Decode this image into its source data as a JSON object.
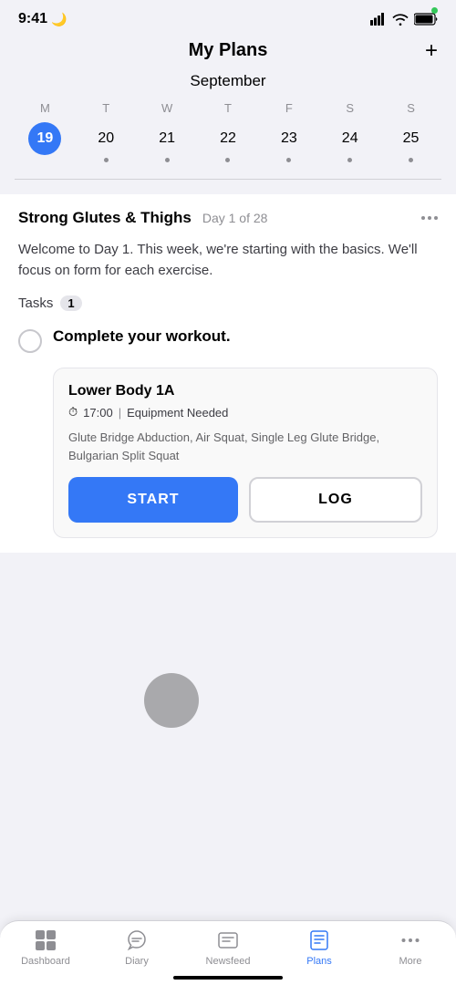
{
  "statusBar": {
    "time": "9:41",
    "moonIcon": "🌙"
  },
  "header": {
    "title": "My Plans",
    "addButton": "+"
  },
  "calendar": {
    "month": "September",
    "dayHeaders": [
      "M",
      "T",
      "W",
      "T",
      "F",
      "S",
      "S"
    ],
    "days": [
      {
        "num": "19",
        "selected": true,
        "dot": false
      },
      {
        "num": "20",
        "selected": false,
        "dot": true
      },
      {
        "num": "21",
        "selected": false,
        "dot": true
      },
      {
        "num": "22",
        "selected": false,
        "dot": true
      },
      {
        "num": "23",
        "selected": false,
        "dot": true
      },
      {
        "num": "24",
        "selected": false,
        "dot": true
      },
      {
        "num": "25",
        "selected": false,
        "dot": true
      }
    ]
  },
  "plan": {
    "title": "Strong Glutes & Thighs",
    "dayLabel": "Day 1 of 28",
    "description": "Welcome to Day 1. This week, we're starting with the basics. We'll focus on form for each exercise.",
    "tasksLabel": "Tasks",
    "tasksBadge": "1",
    "task": {
      "label": "Complete your workout.",
      "completed": false
    },
    "workout": {
      "title": "Lower Body 1A",
      "time": "17:00",
      "separator": "|",
      "equipment": "Equipment Needed",
      "exercises": "Glute Bridge Abduction, Air Squat, Single Leg Glute Bridge, Bulgarian Split Squat",
      "startButton": "START",
      "logButton": "LOG"
    }
  },
  "tabBar": {
    "items": [
      {
        "id": "dashboard",
        "label": "Dashboard",
        "icon": "⊞",
        "active": false
      },
      {
        "id": "diary",
        "label": "Diary",
        "icon": "📥",
        "active": false
      },
      {
        "id": "newsfeed",
        "label": "Newsfeed",
        "icon": "💬",
        "active": false
      },
      {
        "id": "plans",
        "label": "Plans",
        "icon": "📋",
        "active": true
      },
      {
        "id": "more",
        "label": "More",
        "icon": "···",
        "active": false
      }
    ]
  },
  "colors": {
    "accent": "#3478f6",
    "selected": "#3478f6",
    "inactive": "#8e8e93"
  }
}
